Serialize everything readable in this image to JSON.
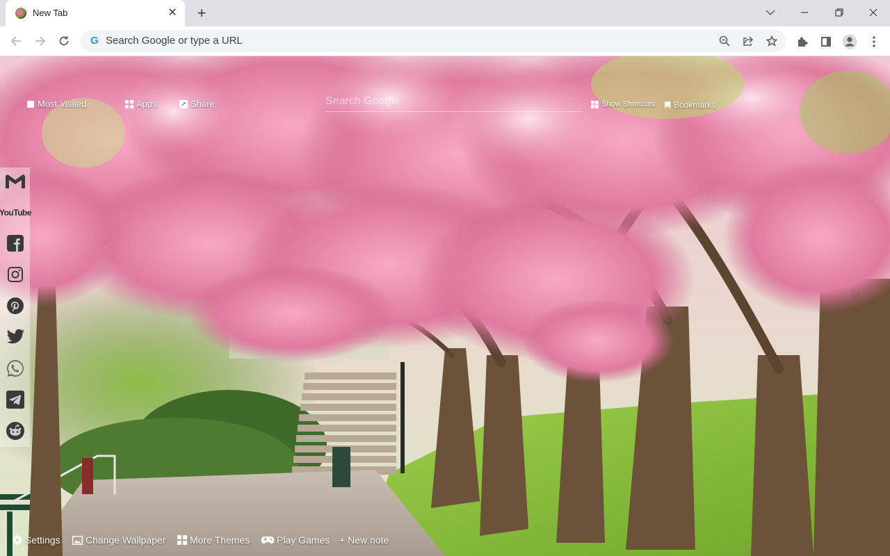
{
  "tab": {
    "title": "New Tab",
    "close_glyph": "✕"
  },
  "new_tab_glyph": "+",
  "omnibox": {
    "placeholder": "Search Google or type a URL",
    "logo": "G"
  },
  "top_links": {
    "most_visited": "Most Visited",
    "apps": "Apps",
    "share": "Share",
    "show_shortcuts": "Show Shortcuts",
    "bookmarks": "Bookmarks"
  },
  "search": {
    "placeholder": "Search Google"
  },
  "sidebar": {
    "youtube_label": "YouTube"
  },
  "bottom_links": {
    "settings": "Settings",
    "change_wallpaper": "Change Wallpaper",
    "more_themes": "More Themes",
    "play_games": "Play Games",
    "new_note": "+ New note"
  },
  "icons": [
    "tab-favicon-icon",
    "close-icon",
    "plus-icon",
    "chevron-down-icon",
    "minimize-icon",
    "restore-icon",
    "window-close-icon",
    "back-arrow-icon",
    "forward-arrow-icon",
    "reload-icon",
    "google-logo-icon",
    "zoom-icon",
    "share-icon",
    "star-icon",
    "extensions-icon",
    "sidepanel-icon",
    "profile-icon",
    "kebab-menu-icon",
    "gmail-icon",
    "youtube-icon",
    "facebook-icon",
    "instagram-icon",
    "pinterest-icon",
    "twitter-icon",
    "whatsapp-icon",
    "telegram-icon",
    "reddit-icon",
    "gear-icon",
    "image-icon",
    "grid-icon",
    "gamepad-icon",
    "bookmark-icon"
  ],
  "colors": {
    "chrome_frame": "#dee1e6",
    "omnibox_bg": "#f1f3f4",
    "blossom_pink": "#e57399",
    "grass_green": "#8cc63f",
    "path_gray": "#b6aaa0"
  }
}
